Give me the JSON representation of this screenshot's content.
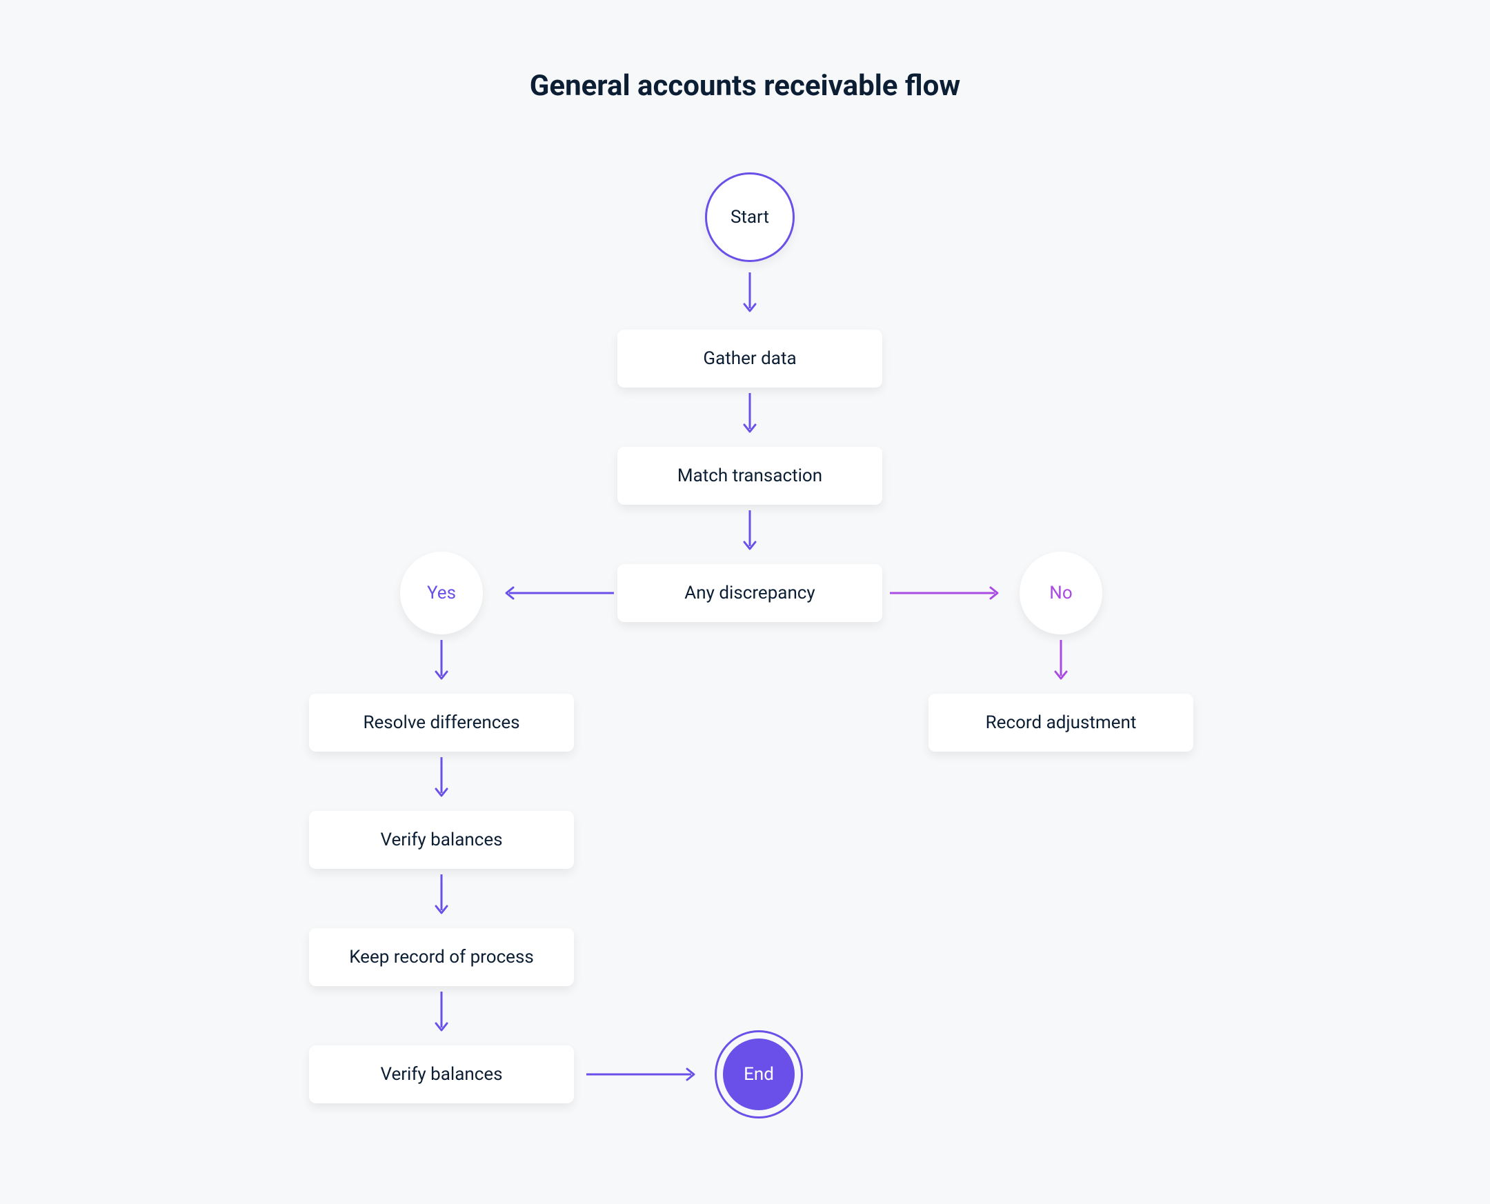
{
  "title": "General accounts receivable flow",
  "nodes": {
    "start": "Start",
    "gather": "Gather data",
    "match": "Match transaction",
    "discrepancy": "Any discrepancy",
    "yes": "Yes",
    "no": "No",
    "resolve": "Resolve differences",
    "verify1": "Verify balances",
    "keep": "Keep record of process",
    "verify2": "Verify balances",
    "record": "Record adjustment",
    "end": "End"
  },
  "colors": {
    "indigo": "#6a50e8",
    "purple": "#a94be3",
    "text": "#0c1e33",
    "bg": "#f6f8fa"
  }
}
